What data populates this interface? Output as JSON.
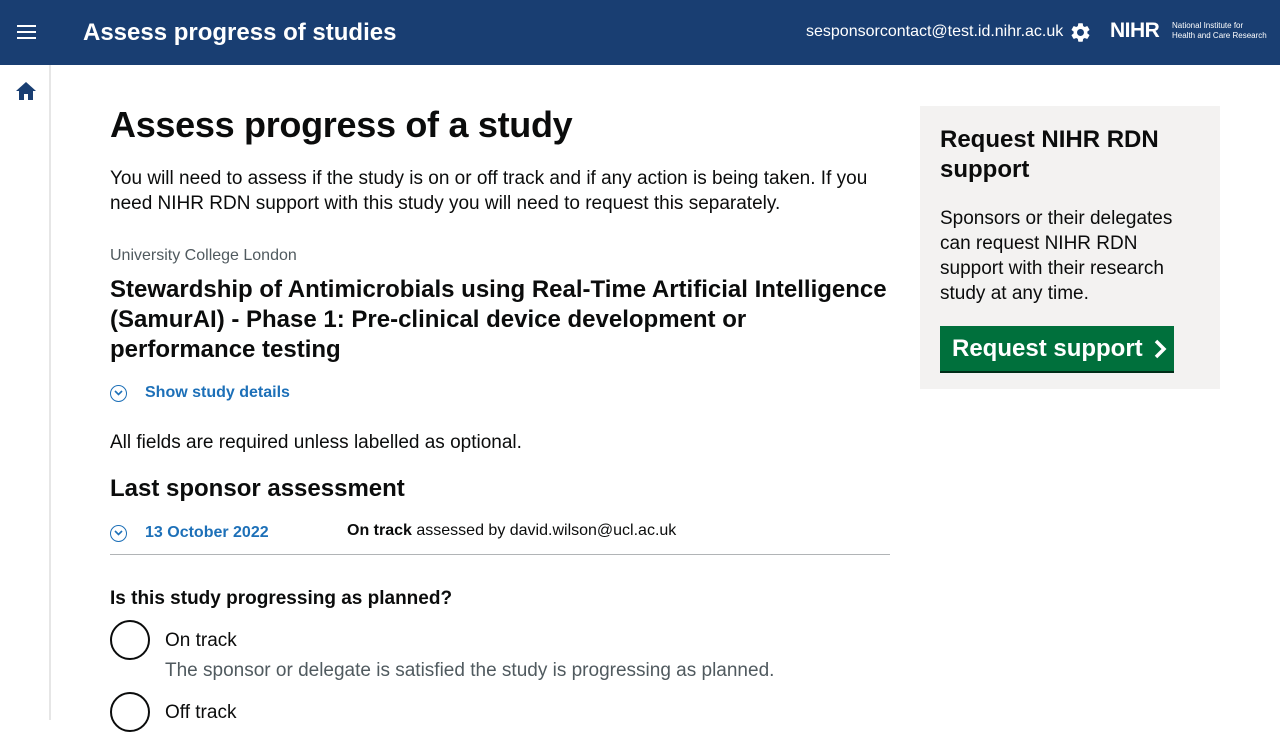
{
  "header": {
    "title": "Assess progress of studies",
    "email": "sesponsorcontact@test.id.nihr.ac.uk",
    "logo_text": "NIHR",
    "logo_subtext_line1": "National Institute for",
    "logo_subtext_line2": "Health and Care Research",
    "menu_icon": "hamburger-menu-icon",
    "settings_icon": "gear-icon"
  },
  "sidebar": {
    "home_icon": "home-icon"
  },
  "main": {
    "page_title": "Assess progress of a study",
    "intro": "You will need to assess if the study is on or off track and if any action is being taken. If you need NIHR RDN support with this study you will need to request this separately.",
    "organisation": "University College London",
    "study_title": "Stewardship of Antimicrobials using Real-Time Artificial Intelligence (SamurAI) - Phase 1: Pre-clinical device development or performance testing",
    "show_details_label": "Show study details",
    "required_note": "All fields are required unless labelled as optional.",
    "last_assessment": {
      "heading": "Last sponsor assessment",
      "date": "13 October 2022",
      "status": "On track",
      "assessed_by_text": "assessed by david.wilson@ucl.ac.uk"
    },
    "question": "Is this study progressing as planned?",
    "options": [
      {
        "label": "On track",
        "hint": "The sponsor or delegate is satisfied the study is progressing as planned."
      },
      {
        "label": "Off track"
      }
    ]
  },
  "aside": {
    "heading": "Request NIHR RDN support",
    "body": "Sponsors or their delegates can request NIHR RDN support with their research study at any time.",
    "button_label": "Request support"
  },
  "colors": {
    "header_bg": "#193e72",
    "link": "#1d70b8",
    "button_green": "#00703c",
    "aside_bg": "#f3f2f1"
  }
}
